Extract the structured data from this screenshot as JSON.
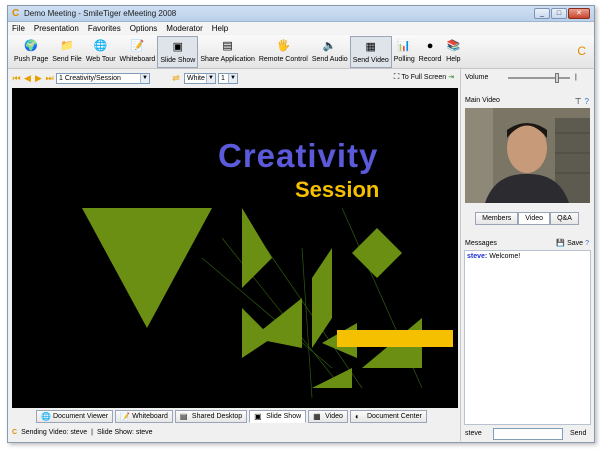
{
  "window": {
    "title": "Demo Meeting - SmileTiger eMeeting 2008",
    "controls": [
      "_",
      "□",
      "✕"
    ]
  },
  "menu": [
    "File",
    "Presentation",
    "Favorites",
    "Options",
    "Moderator",
    "Help"
  ],
  "toolbar": [
    {
      "label": "Push Page",
      "icon": "globe-icon",
      "glyph": "🌍"
    },
    {
      "label": "Send File",
      "icon": "folder-icon",
      "glyph": "📁"
    },
    {
      "label": "Web Tour",
      "icon": "web-tour-icon",
      "glyph": "🌐"
    },
    {
      "label": "Whiteboard",
      "icon": "whiteboard-icon",
      "glyph": "📝"
    },
    {
      "label": "Slide Show",
      "icon": "slideshow-icon",
      "glyph": "▣",
      "pressed": true
    },
    {
      "label": "Share Application",
      "icon": "share-app-icon",
      "glyph": "▤"
    },
    {
      "label": "Remote Control",
      "icon": "remote-control-icon",
      "glyph": "🖐"
    },
    {
      "label": "Send Audio",
      "icon": "speaker-icon",
      "glyph": "🔈"
    },
    {
      "label": "Send Video",
      "icon": "video-icon",
      "glyph": "▦",
      "pressed": true
    },
    {
      "label": "Polling",
      "icon": "poll-chart-icon",
      "glyph": "📊"
    },
    {
      "label": "Record",
      "icon": "record-icon",
      "glyph": "●"
    },
    {
      "label": "Help",
      "icon": "help-icon",
      "glyph": "📚"
    }
  ],
  "nav": {
    "slide_select": "1 Creativity/Session",
    "color_select": "White",
    "size_select": "1",
    "fullscreen_label": "To Full Screen"
  },
  "slide": {
    "title": "Creativity",
    "subtitle": "Session",
    "title_color": "#5a5adb",
    "subtitle_color": "#f5c000",
    "shape_color": "#6b8f12"
  },
  "bottom_tabs": [
    {
      "label": "Document Viewer",
      "icon": "document-viewer-icon",
      "glyph": "🌐"
    },
    {
      "label": "Whiteboard",
      "icon": "whiteboard-icon",
      "glyph": "📝"
    },
    {
      "label": "Shared Desktop",
      "icon": "shared-desktop-icon",
      "glyph": "▤"
    },
    {
      "label": "Slide Show",
      "icon": "slideshow-icon",
      "glyph": "▣",
      "active": true
    },
    {
      "label": "Video",
      "icon": "video-icon",
      "glyph": "▦"
    },
    {
      "label": "Document Center",
      "icon": "document-center-icon",
      "glyph": "◐"
    }
  ],
  "status": {
    "sending_video": "Sending Video:  steve",
    "separator": "|",
    "slide_show": "Slide Show:  steve"
  },
  "right": {
    "volume_label": "Volume",
    "volume_level": 0.85,
    "main_video_label": "Main Video",
    "tabs": [
      {
        "label": "Members"
      },
      {
        "label": "Video",
        "active": true
      },
      {
        "label": "Q&A"
      }
    ],
    "messages_label": "Messages",
    "save_label": "Save",
    "messages": [
      {
        "user": "steve:",
        "text": "Welcome!"
      }
    ],
    "chat_user": "steve",
    "chat_input": "",
    "send_label": "Send"
  }
}
